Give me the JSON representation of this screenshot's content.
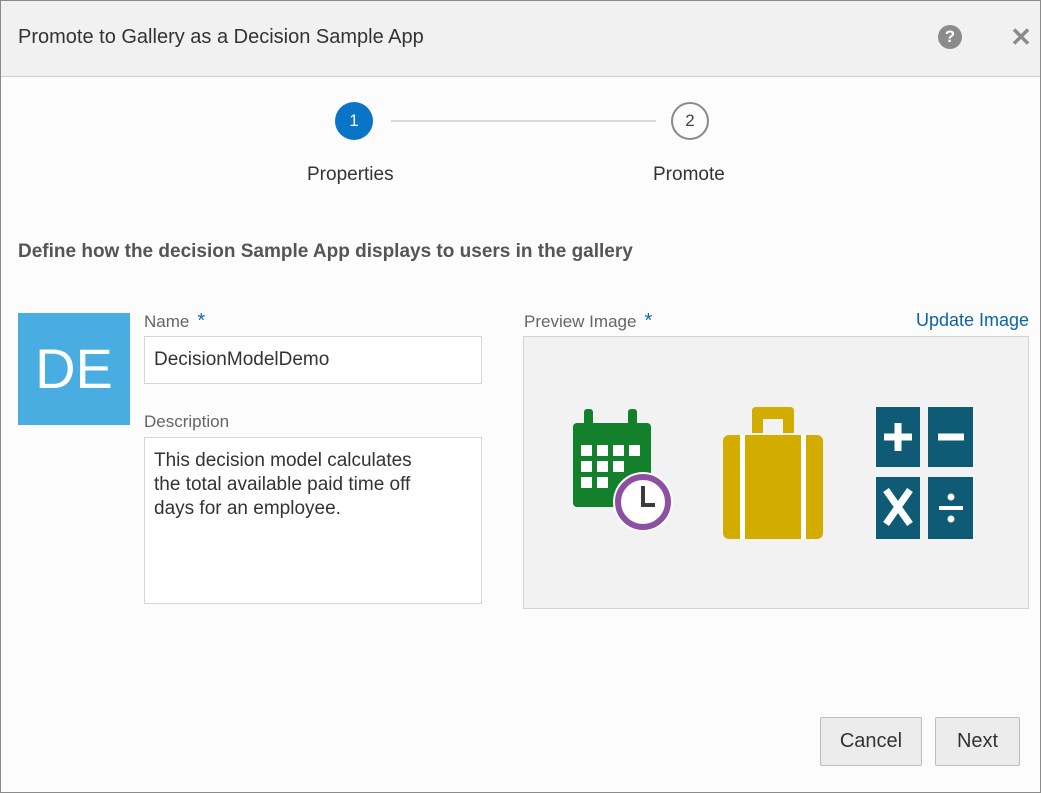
{
  "dialog": {
    "title": "Promote to Gallery as a Decision Sample App",
    "help_glyph": "?",
    "close_glyph": "✕",
    "icons": [
      "help-icon",
      "close-icon"
    ]
  },
  "steps": [
    {
      "number": "1",
      "label": "Properties",
      "state": "active"
    },
    {
      "number": "2",
      "label": "Promote",
      "state": "inactive"
    }
  ],
  "section_heading": "Define how the decision Sample App displays to users in the gallery",
  "avatar": {
    "initials": "DE",
    "color": "#49ade2"
  },
  "form": {
    "name_label": "Name",
    "name_value": "DecisionModelDemo",
    "description_label": "Description",
    "description_value": "This decision model calculates\nthe total available paid time off\ndays for an employee.",
    "required_marker": "*",
    "preview_label": "Preview Image",
    "update_image_link": "Update Image",
    "preview_icons": [
      "calendar-clock-icon",
      "briefcase-icon",
      "calculator-icon"
    ]
  },
  "buttons": {
    "cancel": "Cancel",
    "next": "Next"
  },
  "colors": {
    "accent": "#0a74c7",
    "link": "#0b63a8",
    "calendar": "#13802b",
    "clock": "#8d4fa3",
    "briefcase": "#d2ad00",
    "calculator": "#0f5a74"
  }
}
